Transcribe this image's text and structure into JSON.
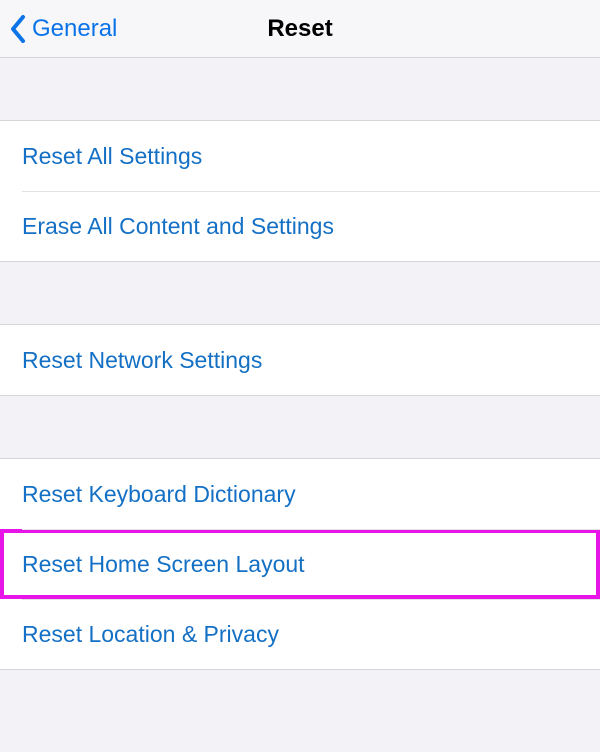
{
  "nav": {
    "back_label": "General",
    "title": "Reset"
  },
  "groups": [
    {
      "cells": [
        {
          "label": "Reset All Settings"
        },
        {
          "label": "Erase All Content and Settings"
        }
      ]
    },
    {
      "cells": [
        {
          "label": "Reset Network Settings"
        }
      ]
    },
    {
      "cells": [
        {
          "label": "Reset Keyboard Dictionary"
        },
        {
          "label": "Reset Home Screen Layout",
          "highlighted": true
        },
        {
          "label": "Reset Location & Privacy"
        }
      ]
    }
  ]
}
